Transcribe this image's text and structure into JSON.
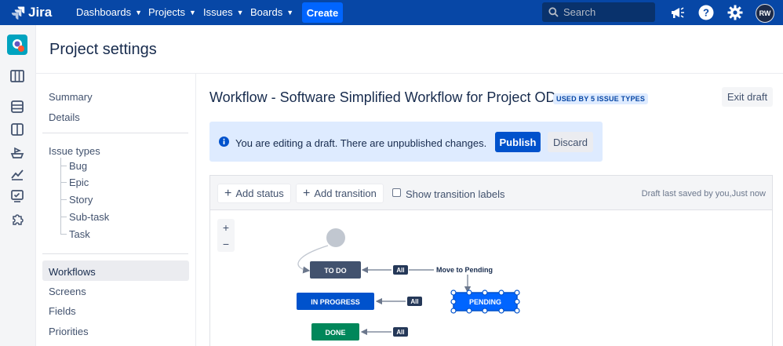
{
  "topnav": {
    "logo_text": "Jira",
    "items": [
      {
        "label": "Dashboards"
      },
      {
        "label": "Projects"
      },
      {
        "label": "Issues"
      },
      {
        "label": "Boards"
      }
    ],
    "create_label": "Create",
    "search_placeholder": "Search",
    "avatar_initials": "RW",
    "icons": [
      "megaphone-icon",
      "help-icon",
      "settings-icon"
    ]
  },
  "rail": {
    "icons": [
      "project-avatar",
      "board-icon",
      "backlog-icon",
      "columns-icon",
      "releases-icon",
      "reports-icon",
      "issues-icon",
      "addons-icon"
    ]
  },
  "page": {
    "title": "Project settings"
  },
  "settings_nav": {
    "summary": "Summary",
    "details": "Details",
    "issue_types": "Issue types",
    "issue_type_children": [
      "Bug",
      "Epic",
      "Story",
      "Sub-task",
      "Task"
    ],
    "workflows": "Workflows",
    "screens": "Screens",
    "fields": "Fields",
    "priorities": "Priorities"
  },
  "workflow": {
    "title": "Workflow - Software Simplified Workflow for Project OD",
    "badge": "USED BY 5 ISSUE TYPES",
    "exit_label": "Exit draft"
  },
  "draft_banner": {
    "text": "You are editing a draft. There are unpublished changes.",
    "publish_label": "Publish",
    "discard_label": "Discard"
  },
  "toolbar": {
    "add_status": "Add status",
    "add_transition": "Add transition",
    "show_labels": "Show transition labels",
    "show_labels_checked": false,
    "saved_text": "Draft last saved by you,Just now"
  },
  "zoom": {
    "in": "+",
    "out": "−"
  },
  "diagram": {
    "statuses": {
      "todo": "TO DO",
      "in_progress": "IN PROGRESS",
      "pending": "PENDING",
      "done": "DONE"
    },
    "all_label": "All",
    "transition_label": "Move to Pending",
    "colors": {
      "todo": "#42526e",
      "in_progress": "#0052cc",
      "done": "#00875a",
      "all_badge": "#253858"
    }
  }
}
